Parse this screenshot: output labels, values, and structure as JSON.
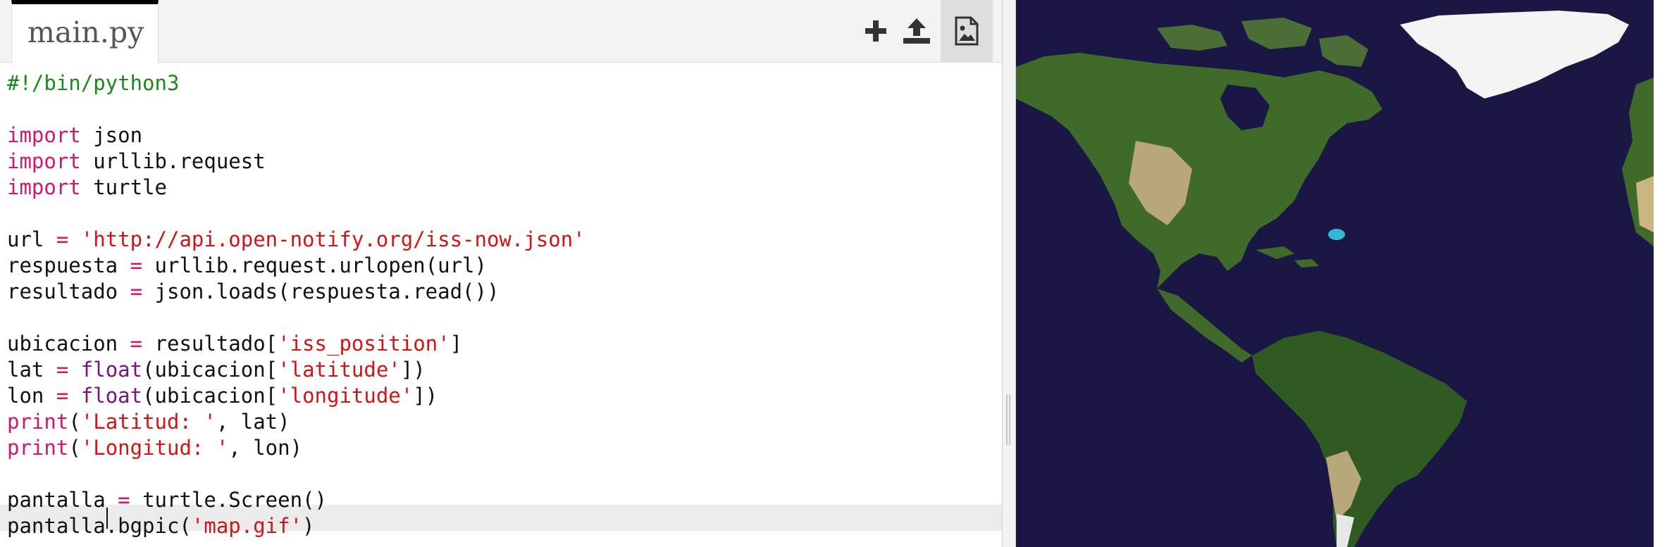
{
  "editor": {
    "tab": {
      "filename": "main.py"
    },
    "toolbar": [
      {
        "name": "add-file-button",
        "icon": "plus-icon"
      },
      {
        "name": "upload-button",
        "icon": "upload-icon"
      },
      {
        "name": "image-button",
        "icon": "image-file-icon"
      }
    ],
    "code": {
      "language": "python",
      "active_line": 18,
      "lines": [
        [
          {
            "t": "#!/bin/python3",
            "c": "cm"
          }
        ],
        [],
        [
          {
            "t": "import",
            "c": "kw"
          },
          {
            "t": " json"
          }
        ],
        [
          {
            "t": "import",
            "c": "kw"
          },
          {
            "t": " urllib.request"
          }
        ],
        [
          {
            "t": "import",
            "c": "kw"
          },
          {
            "t": " turtle"
          }
        ],
        [],
        [
          {
            "t": "url "
          },
          {
            "t": "=",
            "c": "op"
          },
          {
            "t": " "
          },
          {
            "t": "'http://api.open-notify.org/iss-now.json'",
            "c": "st"
          }
        ],
        [
          {
            "t": "respuesta "
          },
          {
            "t": "=",
            "c": "op"
          },
          {
            "t": " urllib.request.urlopen(url)"
          }
        ],
        [
          {
            "t": "resultado "
          },
          {
            "t": "=",
            "c": "op"
          },
          {
            "t": " json.loads(respuesta.read())"
          }
        ],
        [],
        [
          {
            "t": "ubicacion "
          },
          {
            "t": "=",
            "c": "op"
          },
          {
            "t": " resultado["
          },
          {
            "t": "'iss_position'",
            "c": "st"
          },
          {
            "t": "]"
          }
        ],
        [
          {
            "t": "lat "
          },
          {
            "t": "=",
            "c": "op"
          },
          {
            "t": " "
          },
          {
            "t": "float",
            "c": "bi"
          },
          {
            "t": "(ubicacion["
          },
          {
            "t": "'latitude'",
            "c": "st"
          },
          {
            "t": "])"
          }
        ],
        [
          {
            "t": "lon "
          },
          {
            "t": "=",
            "c": "op"
          },
          {
            "t": " "
          },
          {
            "t": "float",
            "c": "bi"
          },
          {
            "t": "(ubicacion["
          },
          {
            "t": "'longitude'",
            "c": "st"
          },
          {
            "t": "])"
          }
        ],
        [
          {
            "t": "print",
            "c": "kw"
          },
          {
            "t": "("
          },
          {
            "t": "'Latitud: '",
            "c": "st"
          },
          {
            "t": ", lat)"
          }
        ],
        [
          {
            "t": "print",
            "c": "kw"
          },
          {
            "t": "("
          },
          {
            "t": "'Longitud: '",
            "c": "st"
          },
          {
            "t": ", lon)"
          }
        ],
        [],
        [
          {
            "t": "pantalla "
          },
          {
            "t": "=",
            "c": "op"
          },
          {
            "t": " turtle.Screen()"
          }
        ],
        [
          {
            "t": "pantalla.bgpic("
          },
          {
            "t": "'map.gif'",
            "c": "st"
          },
          {
            "t": ")"
          }
        ]
      ]
    }
  },
  "output": {
    "image": "world-map",
    "colors": {
      "ocean": "#1a1745",
      "land": "#3f6a2a",
      "desert": "#b9a67a",
      "ice": "#ffffff"
    }
  },
  "colors": {
    "keyword": "#d5156b",
    "builtin": "#7a1184",
    "string": "#d11414",
    "comment": "#1a8a1a",
    "text": "#111111",
    "active_line": "#ebebeb"
  }
}
